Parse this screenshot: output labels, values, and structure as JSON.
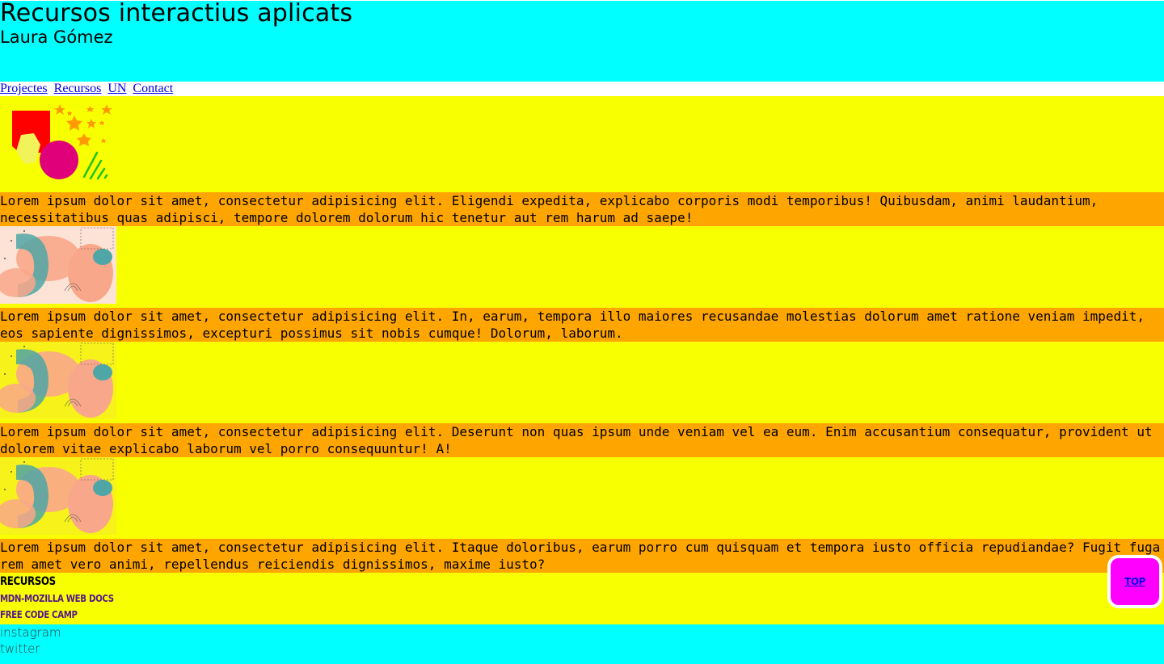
{
  "header": {
    "title": "Recursos interactius aplicats",
    "subtitle": "Laura Gómez"
  },
  "nav": {
    "items": [
      {
        "label": "Projectes"
      },
      {
        "label": "Recursos"
      },
      {
        "label": "UN"
      },
      {
        "label": "Contact"
      }
    ]
  },
  "sections": [
    {
      "text": "Lorem ipsum dolor sit amet, consectetur adipisicing elit. Eligendi expedita, explicabo corporis modi temporibus! Quibusdam, animi laudantium, necessitatibus quas adipisci, tempore dolorem dolorum hic tenetur aut rem harum ad saepe!"
    },
    {
      "text": "Lorem ipsum dolor sit amet, consectetur adipisicing elit. In, earum, tempora illo maiores recusandae molestias dolorum amet ratione veniam impedit, eos sapiente dignissimos, excepturi possimus sit nobis cumque! Dolorum, laborum."
    },
    {
      "text": "Lorem ipsum dolor sit amet, consectetur adipisicing elit. Deserunt non quas ipsum unde veniam vel ea eum. Enim accusantium consequatur, provident ut dolorem vitae explicabo laborum vel porro consequuntur! A!"
    },
    {
      "text": "Lorem ipsum dolor sit amet, consectetur adipisicing elit. Itaque doloribus, earum porro cum quisquam et tempora iusto officia repudiandae? Fugit fuga rem amet vero animi, repellendus reiciendis dignissimos, maxime iusto?"
    }
  ],
  "resources": {
    "heading": "RECURSOS",
    "links": [
      {
        "label": "MDN-MOZILLA WEB DOCS"
      },
      {
        "label": "FREE CODE CAMP"
      }
    ]
  },
  "footer": {
    "social": [
      {
        "label": "instagram"
      },
      {
        "label": "twitter"
      }
    ]
  },
  "top_button": {
    "label": "TOP"
  },
  "colors": {
    "header_bg": "#00ffff",
    "section_bg": "#f8ff00",
    "text_bg": "#ffa500",
    "top_button_bg": "#ff00ff"
  }
}
